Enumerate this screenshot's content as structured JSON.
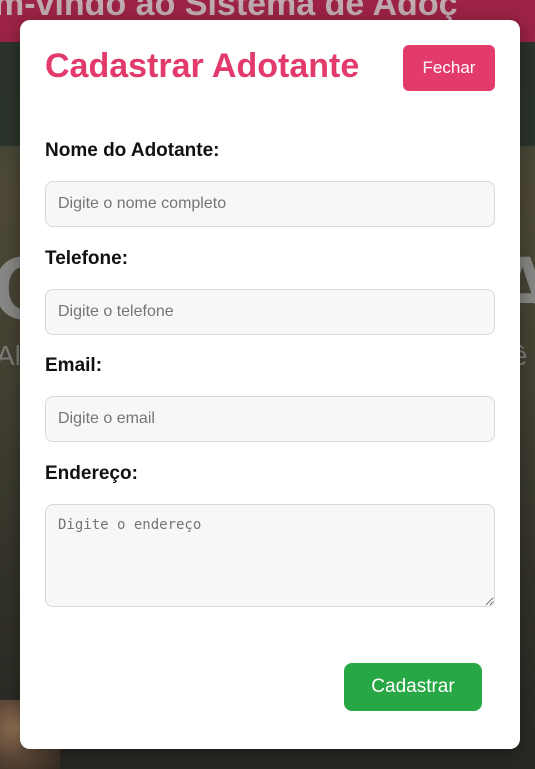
{
  "background": {
    "banner_text": "m-vindo ao Sistema de Adoç",
    "hero_title_left": "C",
    "hero_title_right": "A",
    "hero_sub_left": "Alg",
    "hero_sub_right": "cê"
  },
  "modal": {
    "title": "Cadastrar Adotante",
    "close_label": "Fechar",
    "submit_label": "Cadastrar",
    "fields": [
      {
        "label": "Nome do Adotante:",
        "placeholder": "Digite o nome completo",
        "value": ""
      },
      {
        "label": "Telefone:",
        "placeholder": "Digite o telefone",
        "value": ""
      },
      {
        "label": "Email:",
        "placeholder": "Digite o email",
        "value": ""
      },
      {
        "label": "Endereço:",
        "placeholder": "Digite o endereço",
        "value": ""
      }
    ]
  },
  "colors": {
    "accent": "#e23a6a",
    "submit": "#28a745",
    "banner": "#b2284f"
  }
}
